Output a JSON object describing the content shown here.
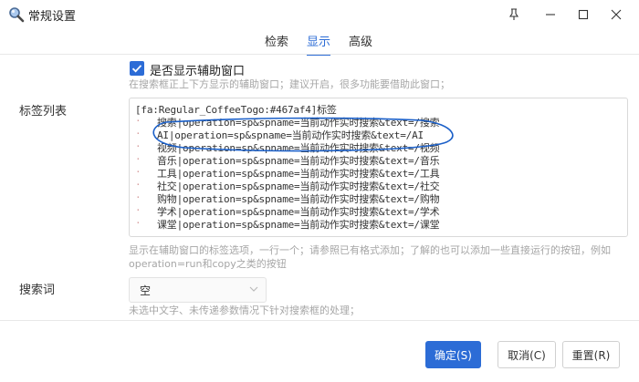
{
  "window": {
    "title": "常规设置",
    "controls": [
      "pin-icon",
      "minimize-icon",
      "maximize-icon",
      "close-icon"
    ]
  },
  "tabs": [
    {
      "label": "检索",
      "active": false
    },
    {
      "label": "显示",
      "active": true
    },
    {
      "label": "高级",
      "active": false
    }
  ],
  "show_helper": {
    "label": "是否显示辅助窗口",
    "checked": true,
    "hint": "在搜索框正上下方显示的辅助窗口；建议开启，很多功能要借助此窗口；"
  },
  "tag_list": {
    "label": "标签列表",
    "lines": [
      "[fa:Regular_CoffeeTogo:#467af4]标签",
      "搜索|operation=sp&spname=当前动作实时搜索&text=/搜索",
      "AI|operation=sp&spname=当前动作实时搜索&text=/AI",
      "视频|operation=sp&spname=当前动作实时搜索&text=/视频",
      "音乐|operation=sp&spname=当前动作实时搜索&text=/音乐",
      "工具|operation=sp&spname=当前动作实时搜索&text=/工具",
      "社交|operation=sp&spname=当前动作实时搜索&text=/社交",
      "购物|operation=sp&spname=当前动作实时搜索&text=/购物",
      "学术|operation=sp&spname=当前动作实时搜索&text=/学术",
      "课堂|operation=sp&spname=当前动作实时搜索&text=/课堂"
    ],
    "hint_line1": "显示在辅助窗口的标签选项，一行一个；请参照已有格式添加；了解的也可以添加一些直接运行的按钮，例如",
    "hint_line2": "operation=run和copy之类的按钮",
    "highlight_color": "#1a5fc8"
  },
  "search_term": {
    "label": "搜索词",
    "value": "空",
    "hint": "未选中文字、未传递参数情况下针对搜索框的处理；"
  },
  "buttons": {
    "ok": "确定(S)",
    "cancel": "取消(C)",
    "reset": "重置(R)"
  },
  "colors": {
    "accent": "#2c6cd6"
  }
}
